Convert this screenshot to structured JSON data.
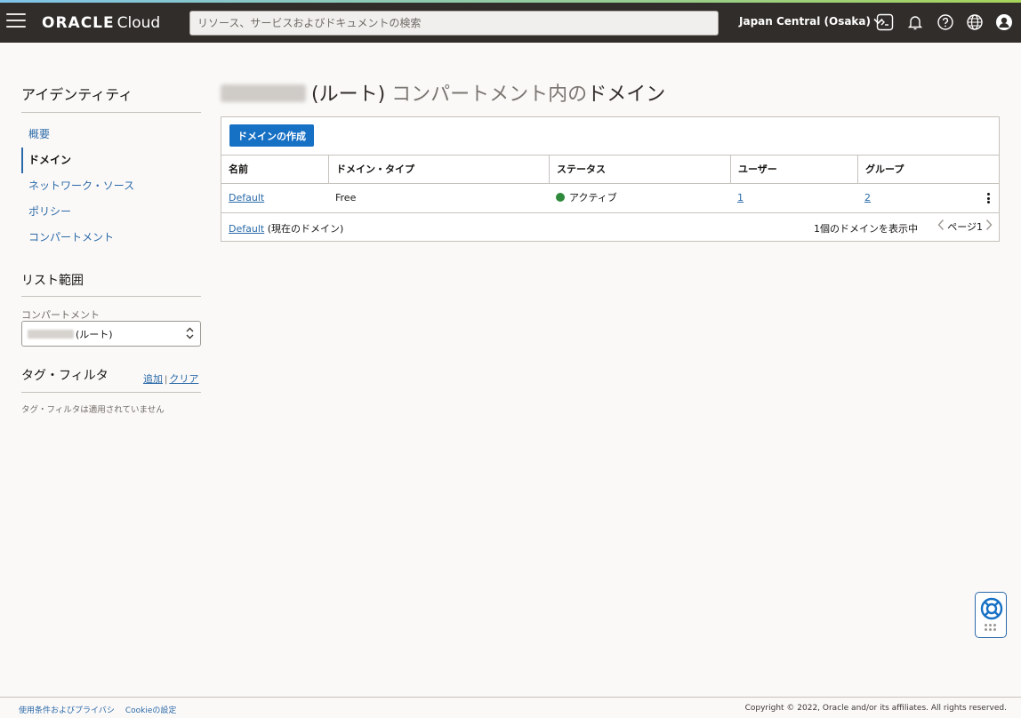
{
  "topbar": {
    "brand_bold": "ORACLE",
    "brand_light": "Cloud",
    "search_placeholder": "リソース、サービスおよびドキュメントの検索",
    "region": "Japan Central (Osaka)"
  },
  "sidebar": {
    "title": "アイデンティティ",
    "items": [
      {
        "label": "概要",
        "active": false
      },
      {
        "label": "ドメイン",
        "active": true
      },
      {
        "label": "ネットワーク・ソース",
        "active": false
      },
      {
        "label": "ポリシー",
        "active": false
      },
      {
        "label": "コンパートメント",
        "active": false
      }
    ],
    "scope_title": "リスト範囲",
    "compartment_label": "コンパートメント",
    "compartment_value": "(ルート)",
    "tag_filter_title": "タグ・フィルタ",
    "tag_add": "追加",
    "tag_sep": "|",
    "tag_clear": "クリア",
    "tag_note": "タグ・フィルタは適用されていません"
  },
  "main": {
    "title_root": "(ルート)",
    "title_rest": "コンパートメント内の",
    "title_end": "ドメイン",
    "create_button": "ドメインの作成",
    "columns": [
      "名前",
      "ドメイン・タイプ",
      "ステータス",
      "ユーザー",
      "グループ"
    ],
    "rows": [
      {
        "name": "Default",
        "type": "Free",
        "status": "アクティブ",
        "users": "1",
        "groups": "2"
      }
    ],
    "footer_link": "Default",
    "footer_note": "(現在のドメイン)",
    "count_text": "1個のドメインを表示中",
    "page_text": "ページ1"
  },
  "colors": {
    "topbar": "#312d2a",
    "accent": "#1670c4",
    "link": "#2b6aa8",
    "status_active": "#2f8a3c"
  },
  "footer": {
    "terms": "使用条件およびプライバシ",
    "cookies": "Cookieの設定",
    "copyright": "Copyright © 2022, Oracle and/or its affiliates. All rights reserved."
  }
}
